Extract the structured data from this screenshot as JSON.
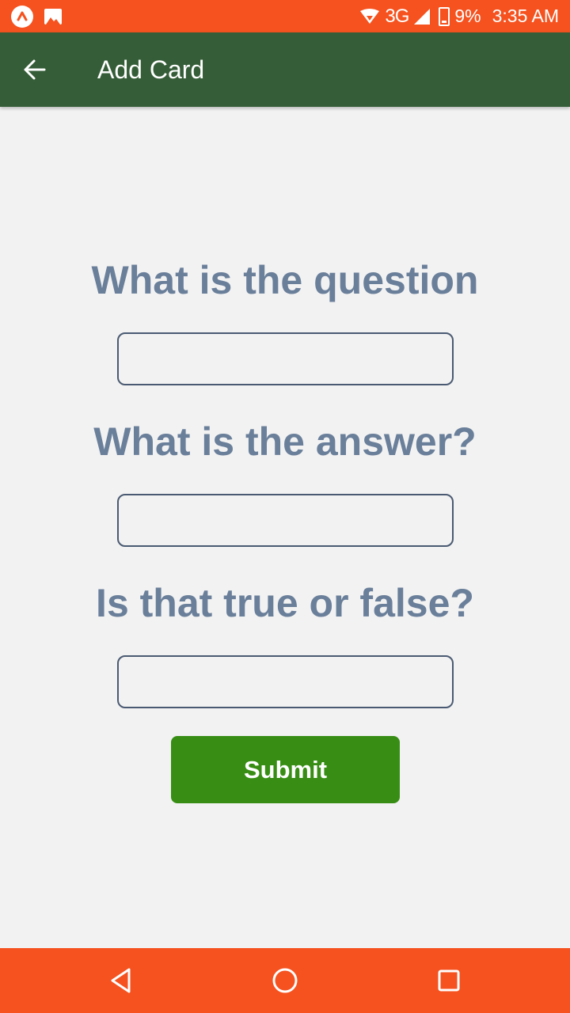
{
  "status_bar": {
    "network": "3G",
    "battery": "9%",
    "time": "3:35 AM",
    "notification_icons": [
      "app-notification-icon",
      "image-notification-icon"
    ],
    "color": "#f5521f"
  },
  "app_bar": {
    "title": "Add Card",
    "back_icon": "arrow-left-icon",
    "color": "#355e38"
  },
  "form": {
    "question_label": "What is the question",
    "question_value": "",
    "answer_label": "What is the answer?",
    "answer_value": "",
    "true_false_label": "Is that true or false?",
    "true_false_value": "",
    "submit_label": "Submit",
    "label_color": "#6a7f9a",
    "submit_color": "#388e14"
  },
  "nav_bar": {
    "buttons": [
      "back-triangle-icon",
      "home-circle-icon",
      "recents-square-icon"
    ],
    "color": "#f5521f"
  }
}
